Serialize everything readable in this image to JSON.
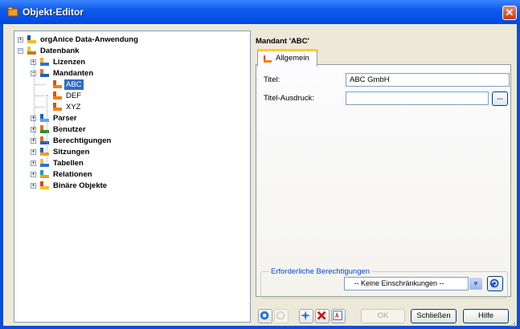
{
  "window": {
    "title": "Objekt-Editor",
    "close_glyph": "✕"
  },
  "tree": {
    "items": [
      {
        "label": "orgAnice Data-Anwendung",
        "icon": "application-icon",
        "expander": "+"
      },
      {
        "label": "Datenbank",
        "icon": "database-icon",
        "expander": "−"
      },
      {
        "label": "Lizenzen",
        "icon": "license-icon",
        "expander": "+"
      },
      {
        "label": "Mandanten",
        "icon": "tenants-icon",
        "expander": "−"
      },
      {
        "label": "ABC",
        "icon": "tenant-icon",
        "selected": true
      },
      {
        "label": "DEF",
        "icon": "tenant-icon"
      },
      {
        "label": "XYZ",
        "icon": "tenant-icon"
      },
      {
        "label": "Parser",
        "icon": "parser-icon",
        "expander": "+"
      },
      {
        "label": "Benutzer",
        "icon": "users-icon",
        "expander": "+"
      },
      {
        "label": "Berechtigungen",
        "icon": "permissions-icon",
        "expander": "+"
      },
      {
        "label": "Sitzungen",
        "icon": "sessions-icon",
        "expander": "+"
      },
      {
        "label": "Tabellen",
        "icon": "tables-icon",
        "expander": "+"
      },
      {
        "label": "Relationen",
        "icon": "relations-icon",
        "expander": "+"
      },
      {
        "label": "Binäre Objekte",
        "icon": "binary-objects-icon",
        "expander": "+"
      }
    ]
  },
  "panel": {
    "title": "Mandant 'ABC'",
    "tab_label": "Allgemein",
    "fields": {
      "titel_label": "Titel:",
      "titel_value": "ABC GmbH",
      "titel_ausdruck_label": "Titel-Ausdruck:",
      "titel_ausdruck_value": "",
      "browse_label": "..."
    },
    "permissions": {
      "group_title": "Erforderliche Berechtigungen",
      "selected_value": "-- Keine Einschränkungen --"
    }
  },
  "toolbar": {
    "ok_label": "OK",
    "close_label": "Schließen",
    "help_label": "Hilfe"
  },
  "colors": {
    "title_bar": "#0f5bec",
    "selection": "#316ac5",
    "group_title": "#0046d5"
  }
}
